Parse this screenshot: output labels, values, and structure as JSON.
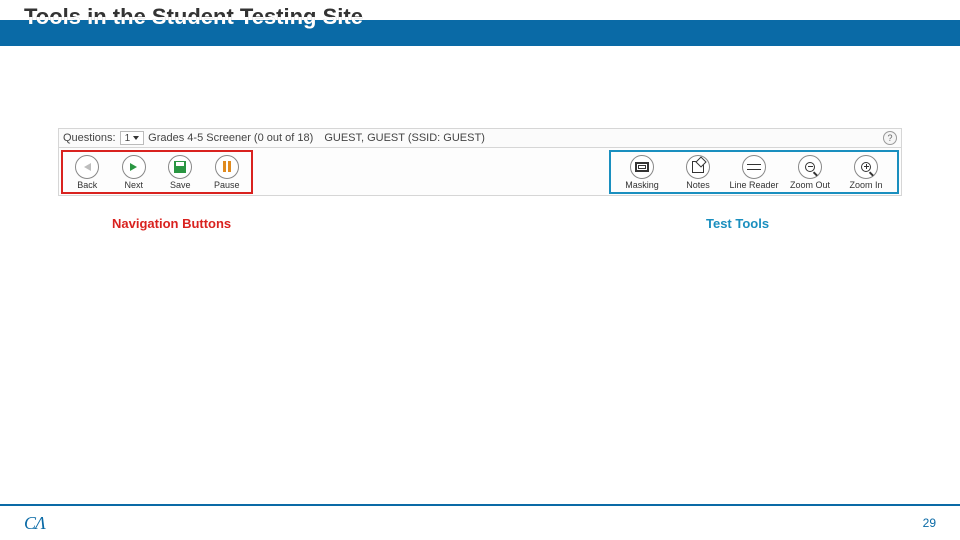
{
  "header": {
    "title": "Tools in the Student Testing Site"
  },
  "status_bar": {
    "questions_label": "Questions:",
    "question_value": "1",
    "test_info": "Grades 4-5 Screener (0 out of 18)",
    "user_info": "GUEST, GUEST (SSID: GUEST)",
    "help": "?"
  },
  "nav_buttons": {
    "back": "Back",
    "next": "Next",
    "save": "Save",
    "pause": "Pause"
  },
  "test_tools": {
    "masking": "Masking",
    "notes": "Notes",
    "line_reader": "Line Reader",
    "zoom_out": "Zoom Out",
    "zoom_in": "Zoom In"
  },
  "callouts": {
    "navigation": "Navigation Buttons",
    "tools": "Test Tools"
  },
  "footer": {
    "logo": "CΛ",
    "page": "29"
  },
  "colors": {
    "blue": "#0a6aa6",
    "red": "#d9221f",
    "teal": "#1a8fbf"
  }
}
